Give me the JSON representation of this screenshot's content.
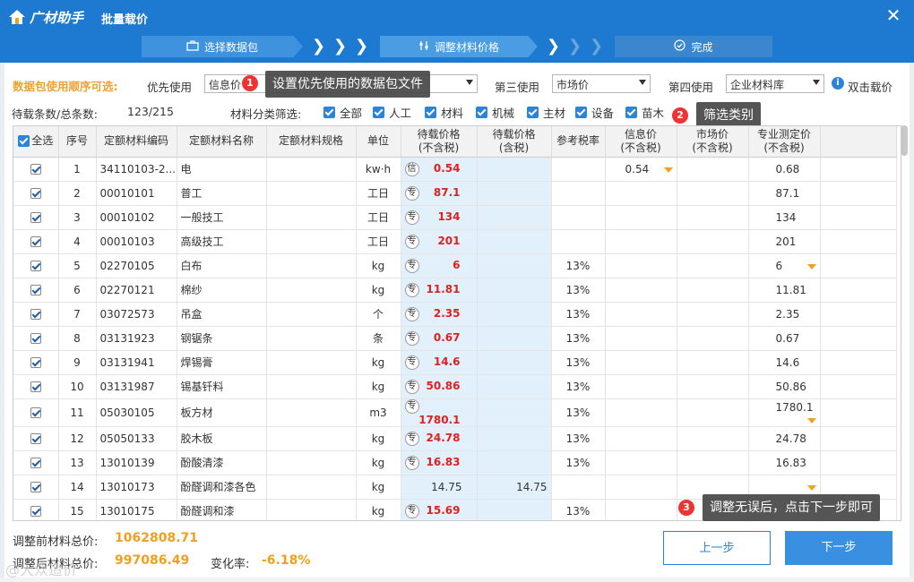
{
  "app": {
    "logo_text": "广材助手",
    "window_title": "批量载价",
    "close_glyph": "✕"
  },
  "steps": {
    "step1": "选择数据包",
    "step2": "调整材料价格",
    "step3": "完成"
  },
  "priority": {
    "label": "数据包使用顺序可选:",
    "first_label": "优先使用",
    "first_value": "信息价",
    "third_label": "第三使用",
    "third_value": "市场价",
    "fourth_label": "第四使用",
    "fourth_value": "企业材料库",
    "dblclick_label": "双击载价"
  },
  "tips": {
    "tip1_num": "1",
    "tip1": "设置优先使用的数据包文件",
    "tip2_num": "2",
    "tip2": "筛选类别",
    "tip3_num": "3",
    "tip3": "调整无误后，点击下一步即可"
  },
  "counts": {
    "label": "待载条数/总条数:",
    "value": "123/215"
  },
  "filters": {
    "label": "材料分类筛选:",
    "items": [
      "全部",
      "人工",
      "材料",
      "机械",
      "主材",
      "设备",
      "苗木"
    ]
  },
  "table": {
    "headers": {
      "select_all": "全选",
      "seq": "序号",
      "code": "定额材料编码",
      "name": "定额材料名称",
      "spec": "定额材料规格",
      "unit": "单位",
      "price_ex_1": "待载价格",
      "price_ex_2": "(不含税)",
      "price_in_1": "待载价格",
      "price_in_2": "(含税)",
      "tax": "参考税率",
      "info_1": "信息价",
      "info_2": "(不含税)",
      "market_1": "市场价",
      "market_2": "(不含税)",
      "pro_1": "专业测定价",
      "pro_2": "(不含税)"
    },
    "rows": [
      {
        "seq": "1",
        "code": "34110103-2...",
        "name": "电",
        "unit": "kw·h",
        "tag": "信",
        "price_ex": "0.54",
        "price_in": "",
        "tax": "",
        "info": "0.54",
        "info_dd": true,
        "market": "",
        "pro": "0.68",
        "pro_dd": false
      },
      {
        "seq": "2",
        "code": "00010101",
        "name": "普工",
        "unit": "工日",
        "tag": "专",
        "price_ex": "87.1",
        "price_in": "",
        "tax": "",
        "info": "",
        "info_dd": false,
        "market": "",
        "pro": "87.1",
        "pro_dd": false
      },
      {
        "seq": "3",
        "code": "00010102",
        "name": "一般技工",
        "unit": "工日",
        "tag": "专",
        "price_ex": "134",
        "price_in": "",
        "tax": "",
        "info": "",
        "info_dd": false,
        "market": "",
        "pro": "134",
        "pro_dd": false
      },
      {
        "seq": "4",
        "code": "00010103",
        "name": "高级技工",
        "unit": "工日",
        "tag": "专",
        "price_ex": "201",
        "price_in": "",
        "tax": "",
        "info": "",
        "info_dd": false,
        "market": "",
        "pro": "201",
        "pro_dd": false
      },
      {
        "seq": "5",
        "code": "02270105",
        "name": "白布",
        "unit": "kg",
        "tag": "专",
        "price_ex": "6",
        "price_in": "",
        "tax": "13%",
        "info": "",
        "info_dd": false,
        "market": "",
        "pro": "6",
        "pro_dd": true
      },
      {
        "seq": "6",
        "code": "02270121",
        "name": "棉纱",
        "unit": "kg",
        "tag": "专",
        "price_ex": "11.81",
        "price_in": "",
        "tax": "13%",
        "info": "",
        "info_dd": false,
        "market": "",
        "pro": "11.81",
        "pro_dd": false
      },
      {
        "seq": "7",
        "code": "03072573",
        "name": "吊盒",
        "unit": "个",
        "tag": "专",
        "price_ex": "2.35",
        "price_in": "",
        "tax": "13%",
        "info": "",
        "info_dd": false,
        "market": "",
        "pro": "2.35",
        "pro_dd": false
      },
      {
        "seq": "8",
        "code": "03131923",
        "name": "钢锯条",
        "unit": "条",
        "tag": "专",
        "price_ex": "0.67",
        "price_in": "",
        "tax": "13%",
        "info": "",
        "info_dd": false,
        "market": "",
        "pro": "0.67",
        "pro_dd": false
      },
      {
        "seq": "9",
        "code": "03131941",
        "name": "焊锡膏",
        "unit": "kg",
        "tag": "专",
        "price_ex": "14.6",
        "price_in": "",
        "tax": "13%",
        "info": "",
        "info_dd": false,
        "market": "",
        "pro": "14.6",
        "pro_dd": false
      },
      {
        "seq": "10",
        "code": "03131987",
        "name": "锡基钎料",
        "unit": "kg",
        "tag": "专",
        "price_ex": "50.86",
        "price_in": "",
        "tax": "13%",
        "info": "",
        "info_dd": false,
        "market": "",
        "pro": "50.86",
        "pro_dd": false
      },
      {
        "seq": "11",
        "code": "05030105",
        "name": "板方材",
        "unit": "m3",
        "tag": "专",
        "price_ex": "1780.1",
        "price_in": "",
        "tax": "13%",
        "info": "",
        "info_dd": false,
        "market": "",
        "pro": "1780.1",
        "pro_dd": true
      },
      {
        "seq": "12",
        "code": "05050133",
        "name": "胶木板",
        "unit": "kg",
        "tag": "专",
        "price_ex": "24.78",
        "price_in": "",
        "tax": "13%",
        "info": "",
        "info_dd": false,
        "market": "",
        "pro": "24.78",
        "pro_dd": false
      },
      {
        "seq": "13",
        "code": "13010139",
        "name": "酚酸清漆",
        "unit": "kg",
        "tag": "专",
        "price_ex": "16.83",
        "price_in": "",
        "tax": "13%",
        "info": "",
        "info_dd": false,
        "market": "",
        "pro": "16.83",
        "pro_dd": false
      },
      {
        "seq": "14",
        "code": "13010173",
        "name": "酚醛调和漆各色",
        "unit": "kg",
        "tag": "",
        "price_ex": "14.75",
        "price_in": "14.75",
        "tax": "",
        "info": "",
        "info_dd": false,
        "market": "",
        "pro": "",
        "pro_dd": true
      },
      {
        "seq": "15",
        "code": "13010175",
        "name": "酚醛调和漆",
        "unit": "kg",
        "tag": "专",
        "price_ex": "15.69",
        "price_in": "",
        "tax": "13%",
        "info": "",
        "info_dd": false,
        "market": "",
        "pro": "",
        "pro_dd": false
      }
    ]
  },
  "footer": {
    "before_label": "调整前材料总价:",
    "before_value": "1062808.71",
    "after_label": "调整后材料总价:",
    "after_value": "997086.49",
    "change_label": "变化率:",
    "change_value": "-6.18%",
    "prev_btn": "上一步",
    "next_btn": "下一步"
  },
  "watermark": "@大众造价"
}
